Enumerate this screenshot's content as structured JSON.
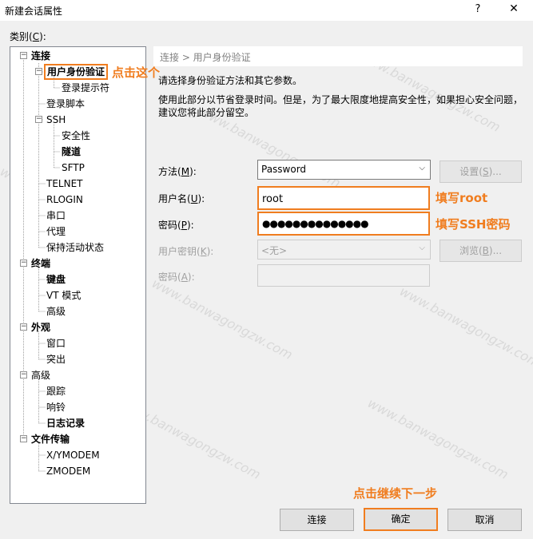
{
  "window": {
    "title": "新建会话属性",
    "help": "?",
    "close": "✕"
  },
  "category": {
    "label": "类别",
    "mnemonic": "C"
  },
  "tree": {
    "connection": "连接",
    "user_auth": "用户身份验证",
    "login_prompt": "登录提示符",
    "login_script": "登录脚本",
    "ssh": "SSH",
    "security": "安全性",
    "tunnel": "隧道",
    "sftp": "SFTP",
    "telnet": "TELNET",
    "rlogin": "RLOGIN",
    "serial": "串口",
    "proxy": "代理",
    "keepalive": "保持活动状态",
    "terminal": "终端",
    "keyboard": "键盘",
    "vt_mode": "VT 模式",
    "terminal_advanced": "高级",
    "appearance": "外观",
    "window": "窗口",
    "highlight": "突出",
    "advanced": "高级",
    "trace": "跟踪",
    "bell": "响铃",
    "logging": "日志记录",
    "file_transfer": "文件传输",
    "xymodem": "X/YMODEM",
    "zmodem": "ZMODEM"
  },
  "breadcrumb": "连接 > 用户身份验证",
  "description": {
    "line1": "请选择身份验证方法和其它参数。",
    "line2": "使用此部分以节省登录时间。但是，为了最大限度地提高安全性，如果担心安全问题，",
    "line3": "建议您将此部分留空。"
  },
  "form": {
    "method_label": "方法",
    "method_key": "M",
    "method_value": "Password",
    "settings_button": "设置",
    "settings_key": "S",
    "username_label": "用户名",
    "username_key": "U",
    "username_value": "root",
    "password_label": "密码",
    "password_key": "P",
    "password_value": "●●●●●●●●●●●●●●",
    "user_key_label": "用户密钥",
    "user_key_key": "K",
    "user_key_value": "<无>",
    "browse_button": "浏览",
    "browse_key": "B",
    "passphrase_label": "密码",
    "passphrase_key": "A",
    "ellipsis": "(...)"
  },
  "buttons": {
    "connect": "连接",
    "ok": "确定",
    "cancel": "取消"
  },
  "annotations": {
    "click_this": "点击这个",
    "fill_root": "填写root",
    "fill_ssh_password": "填写SSH密码",
    "click_continue": "点击继续下一步"
  },
  "watermark": "www.banwagongzw.com",
  "colors": {
    "annotation": "#f07d1f",
    "tree_border": "#828790"
  }
}
